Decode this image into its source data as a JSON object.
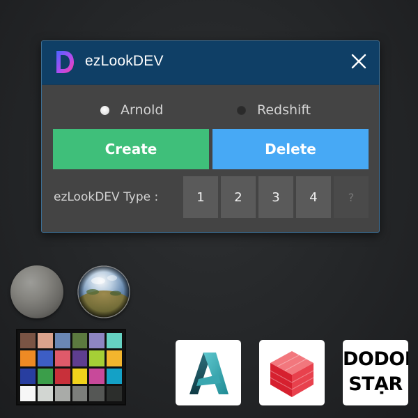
{
  "window": {
    "title": "ezLookDEV",
    "logo_letter": "D",
    "close_glyph": "close-icon"
  },
  "renderers": {
    "options": [
      {
        "label": "Arnold",
        "selected": true
      },
      {
        "label": "Redshift",
        "selected": false
      }
    ]
  },
  "actions": {
    "create_label": "Create",
    "delete_label": "Delete"
  },
  "type_selector": {
    "label": "ezLookDEV Type :",
    "buttons": [
      "1",
      "2",
      "3",
      "4"
    ],
    "help_label": "?"
  },
  "colors": {
    "titlebar": "#0f3f66",
    "panel": "#444444",
    "create_button": "#3fbf7a",
    "delete_button": "#47a9f5",
    "type_button": "#5a5a5a"
  },
  "color_checker": {
    "patches": [
      "#7a5444",
      "#dba38c",
      "#6a87b4",
      "#5c7a3f",
      "#8e85c2",
      "#66d2c2",
      "#ee8a24",
      "#3d5ec5",
      "#df5a6a",
      "#5e3e8f",
      "#a5cf36",
      "#f3b52d",
      "#283ea0",
      "#3b9e4a",
      "#c8303a",
      "#f1d21c",
      "#c8499a",
      "#14a1c6",
      "#f7f7f7",
      "#d2d6d2",
      "#a9aba8",
      "#7c7e7b",
      "#555755",
      "#2c2e2c"
    ]
  },
  "logos": {
    "maya": "maya-logo-icon",
    "redshift": "redshift-logo-icon",
    "dodoe": {
      "line1": "DODOE",
      "line2": "STẠR"
    }
  }
}
